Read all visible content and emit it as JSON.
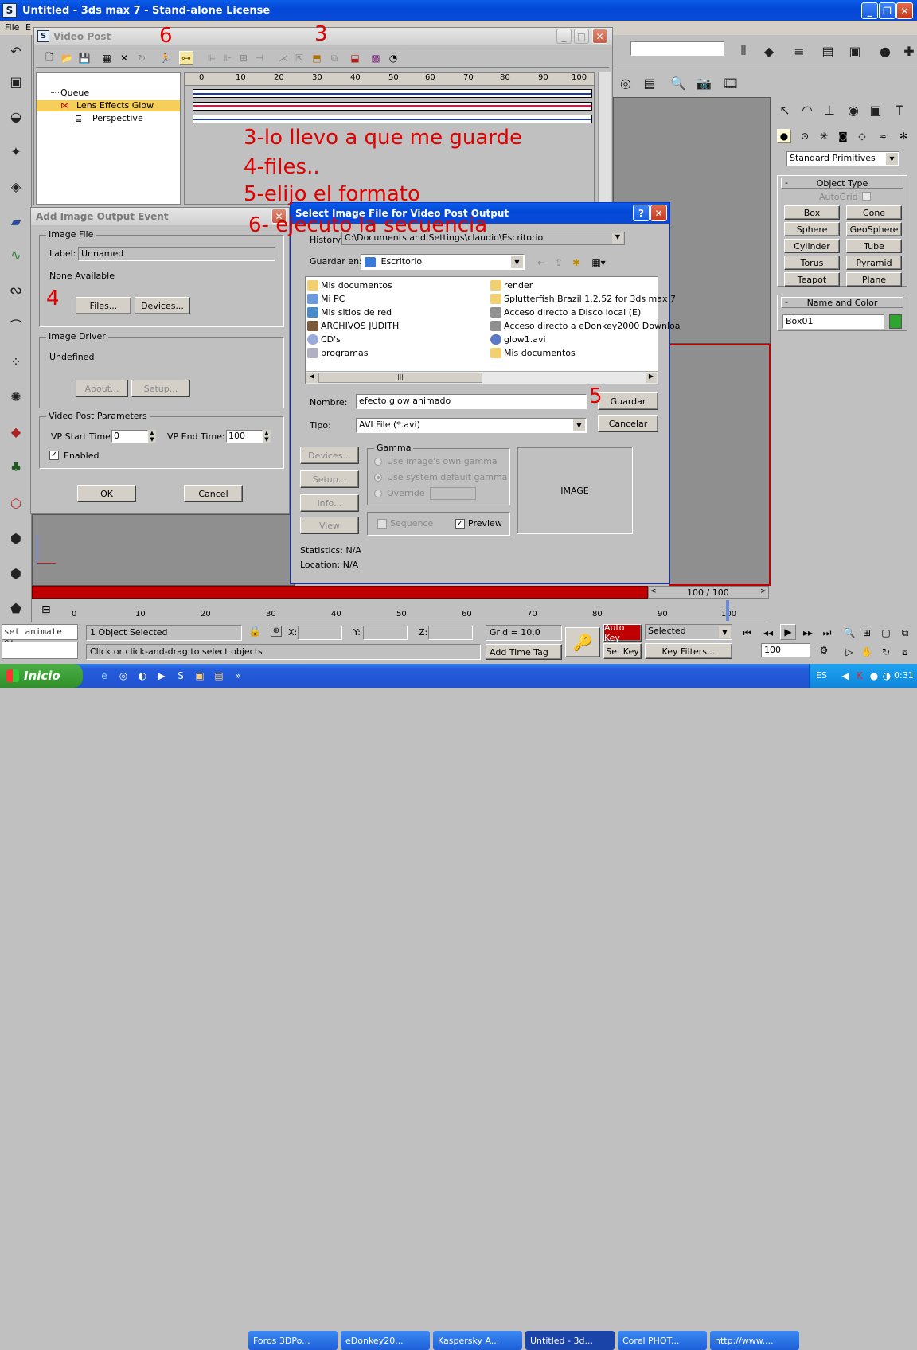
{
  "main": {
    "title": "Untitled - 3ds max 7  - Stand-alone License",
    "menu": [
      "File",
      "E"
    ]
  },
  "video_post": {
    "title": "Video Post",
    "queue": [
      "Queue",
      "Lens Effects Glow",
      "Perspective"
    ],
    "ruler": [
      "0",
      "10",
      "20",
      "30",
      "40",
      "50",
      "60",
      "70",
      "80",
      "90",
      "100"
    ]
  },
  "annotations": {
    "n6": "6",
    "n3": "3",
    "n4": "4",
    "n5": "5",
    "line1": "3-lo llevo a que me guarde",
    "line2": "4-files..",
    "line3": "5-elijo el formato",
    "line4": "6- ejecuto la secuencia"
  },
  "add_event": {
    "title": "Add Image Output Event",
    "image_file_group": "Image File",
    "label_caption": "Label:",
    "label_value": "Unnamed",
    "none_available": "None Available",
    "files_btn": "Files...",
    "devices_btn": "Devices...",
    "driver_group": "Image Driver",
    "undefined": "Undefined",
    "about_btn": "About...",
    "setup_btn": "Setup...",
    "params_group": "Video Post Parameters",
    "vp_start_label": "VP Start Time:",
    "vp_start": "0",
    "vp_end_label": "VP End Time:",
    "vp_end": "100",
    "enabled": "Enabled",
    "ok": "OK",
    "cancel": "Cancel"
  },
  "select_file": {
    "title": "Select Image File for Video Post Output",
    "history_label": "History:",
    "history_value": "C:\\Documents and Settings\\claudio\\Escritorio",
    "save_in_label": "Guardar en:",
    "save_in_value": "Escritorio",
    "left_items": [
      "Mis documentos",
      "Mi PC",
      "Mis sitios de red",
      "ARCHIVOS JUDITH",
      "CD's",
      "programas"
    ],
    "right_items": [
      "render",
      "Splutterfish Brazil 1.2.52 for 3ds max 7",
      "Acceso directo a Disco local (E)",
      "Acceso directo a eDonkey2000 Downloa",
      "glow1.avi",
      "Mis documentos"
    ],
    "name_label": "Nombre:",
    "name_value": "efecto glow animado",
    "type_label": "Tipo:",
    "type_value": "AVI File (*.avi)",
    "save_btn": "Guardar",
    "cancel_btn": "Cancelar",
    "devices_btn": "Devices...",
    "setup_btn": "Setup...",
    "info_btn": "Info...",
    "view_btn": "View",
    "gamma_group": "Gamma",
    "gamma_own": "Use image's own gamma",
    "gamma_default": "Use system default gamma",
    "gamma_override": "Override",
    "sequence": "Sequence",
    "preview": "Preview",
    "image_label": "IMAGE",
    "statistics": "Statistics:  N/A",
    "location": "Location:  N/A"
  },
  "command_panel": {
    "dropdown": "Standard Primitives",
    "object_type": "Object Type",
    "autogrid": "AutoGrid",
    "buttons": [
      "Box",
      "Cone",
      "Sphere",
      "GeoSphere",
      "Cylinder",
      "Tube",
      "Torus",
      "Pyramid",
      "Teapot",
      "Plane"
    ],
    "name_color": "Name and Color",
    "name_value": "Box01",
    "swatch_color": "#2fa52f"
  },
  "timeline": {
    "counter": "100 / 100",
    "ticks": [
      "0",
      "10",
      "20",
      "30",
      "40",
      "50",
      "60",
      "70",
      "80",
      "90",
      "100"
    ]
  },
  "status": {
    "script": "set animate o:",
    "selection": "1 Object Selected",
    "prompt": "Click or click-and-drag to select objects",
    "x": "X:",
    "y": "Y:",
    "z": "Z:",
    "grid": "Grid = 10,0",
    "add_time_tag": "Add Time Tag",
    "auto_key": "Auto Key",
    "set_key": "Set Key",
    "selected": "Selected",
    "key_filters": "Key Filters...",
    "frame": "100"
  },
  "taskbar": {
    "start": "Inicio",
    "tasks": [
      "Foros 3DPo...",
      "eDonkey20...",
      "Kaspersky A...",
      "Untitled - 3d...",
      "Corel PHOT...",
      "http://www...."
    ],
    "lang": "ES",
    "clock": "0:31"
  }
}
